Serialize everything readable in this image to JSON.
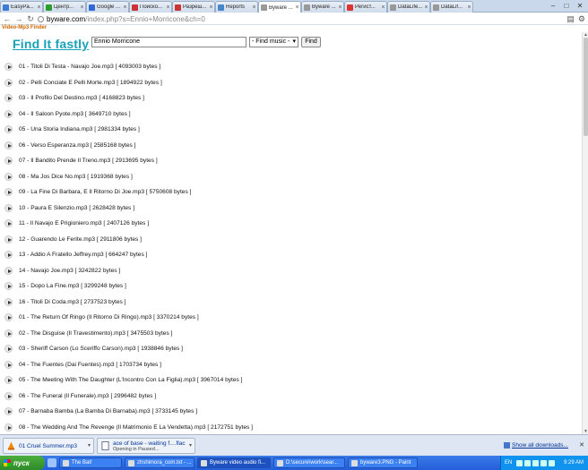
{
  "tabs": [
    {
      "title": "EasyPa...",
      "color": "#3b7bd8",
      "active": false
    },
    {
      "title": "Центр...",
      "color": "#2a9d2a",
      "active": false
    },
    {
      "title": "Google ...",
      "color": "#3367d6",
      "active": false
    },
    {
      "title": "Поиско...",
      "color": "#cc3333",
      "active": false
    },
    {
      "title": "Разреш...",
      "color": "#cc3333",
      "active": false
    },
    {
      "title": "Reports",
      "color": "#4488cc",
      "active": false
    },
    {
      "title": "Byware ...",
      "color": "#999999",
      "active": true
    },
    {
      "title": "Byware ...",
      "color": "#999999",
      "active": false
    },
    {
      "title": "Регист...",
      "color": "#dd3333",
      "active": false
    },
    {
      "title": "DataLife...",
      "color": "#999999",
      "active": false
    },
    {
      "title": "DataLif...",
      "color": "#999999",
      "active": false
    }
  ],
  "address": {
    "host": "byware.com",
    "path": "/index.php?s=Ennio+Morricone&ch=0"
  },
  "bookmark_label": "Video-Mp3 Finder",
  "logo": "Find It fastly",
  "search": {
    "value": "Ennio Morricone",
    "select_value": "- Find music -",
    "button_label": "Find"
  },
  "results": [
    "01 - Titoli Di Testa - Navajo Joe.mp3 [ 4093003 bytes ]",
    "02 - Pelli Conciate E Pelli Morte.mp3 [ 1894922 bytes ]",
    "03 - Il Profilo Del Destino.mp3 [ 4168823 bytes ]",
    "04 - Il Saloon Pyote.mp3 [ 3649710 bytes ]",
    "05 - Una Storia Indiana.mp3 [ 2981334 bytes ]",
    "06 - Verso Esperanza.mp3 [ 2585168 bytes ]",
    "07 - Il Bandito Prende Il Treno.mp3 [ 2913695 bytes ]",
    "08 - Ma Jos Dice No.mp3 [ 1919368 bytes ]",
    "09 - La Fine Di Barbara, E Il Ritorno Di Joe.mp3 [ 5750608 bytes ]",
    "10 - Paura E Silenzio.mp3 [ 2628428 bytes ]",
    "11 - Il Navajo E Prigioniero.mp3 [ 2407126 bytes ]",
    "12 - Guarendo Le Ferite.mp3 [ 2911806 bytes ]",
    "13 - Addio A Fratello Jeffrey.mp3 [ 664247 bytes ]",
    "14 - Navajo Joe.mp3 [ 3242822 bytes ]",
    "15 - Dopo La Fine.mp3 [ 3299248 bytes ]",
    "16 - Titoli Di Coda.mp3 [ 2737523 bytes ]",
    "01 - The Return Of Ringo (Il Ritorno Di Ringo).mp3 [ 3370214 bytes ]",
    "02 - The Disguise (Il Travestimento).mp3 [ 3475503 bytes ]",
    "03 - Sheriff Carson (Lo Sceriffo Carson).mp3 [ 1938846 bytes ]",
    "04 - The Fuentes (Dai Fuentes).mp3 [ 1703734 bytes ]",
    "05 - The Meeting With The Daughter (L'Incontro Con La Figlia).mp3 [ 3967014 bytes ]",
    "06 - The Funeral (Il Funerale).mp3 [ 2996482 bytes ]",
    "07 - Barnaba Bamba (La Bamba Di Barnaba).mp3 [ 3733145 bytes ]",
    "08 - The Wedding And The Revenge (Il Matrimonio E La Vendetta).mp3 [ 2172751 bytes ]"
  ],
  "downloads": [
    {
      "name": "01 Cruel Summer.mp3",
      "sub": ""
    },
    {
      "name": "ace of base - waiting f....flac",
      "sub": "Opening in Paused..."
    }
  ],
  "show_all_downloads": "Show all downloads...",
  "taskbar": {
    "start_label": "пуск",
    "tasks": [
      {
        "label": "The Bat!",
        "active": false
      },
      {
        "label": "zhshimora_com.txt - ...",
        "active": false
      },
      {
        "label": "Byware video audio fi...",
        "active": true
      },
      {
        "label": "D:\\secure\\work\\sear...",
        "active": false
      },
      {
        "label": "byware3.PNG - Paint",
        "active": false
      }
    ],
    "lang": "EN",
    "clock": "9:29 AM"
  }
}
